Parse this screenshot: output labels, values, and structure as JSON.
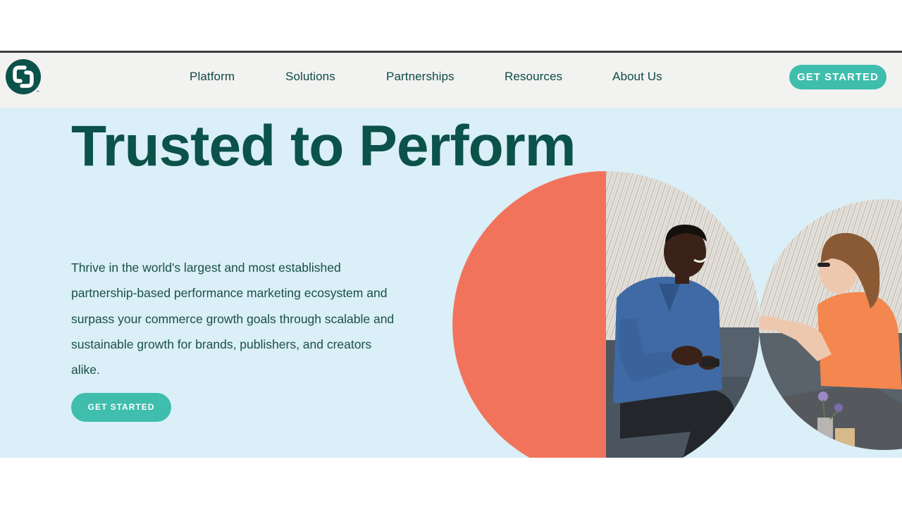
{
  "header": {
    "logo_icon": "cj-logo-icon",
    "logo_tm": "™",
    "nav": [
      "Platform",
      "Solutions",
      "Partnerships",
      "Resources",
      "About Us"
    ],
    "cta": "GET STARTED"
  },
  "hero": {
    "headline": "Trusted to Perform",
    "body": "Thrive in the world's largest and most established partnership-based performance marketing ecosystem and surpass your commerce growth goals through scalable and sustainable growth for brands, publishers, and creators alike.",
    "cta": "GET STARTED",
    "image": "people-conversation-photo-icon"
  },
  "colors": {
    "brand_dark": "#0b524a",
    "accent_teal": "#3fbdad",
    "hero_bg": "#daeff7",
    "coral": "#f2735c",
    "nav_bg": "#f2f2f0"
  }
}
